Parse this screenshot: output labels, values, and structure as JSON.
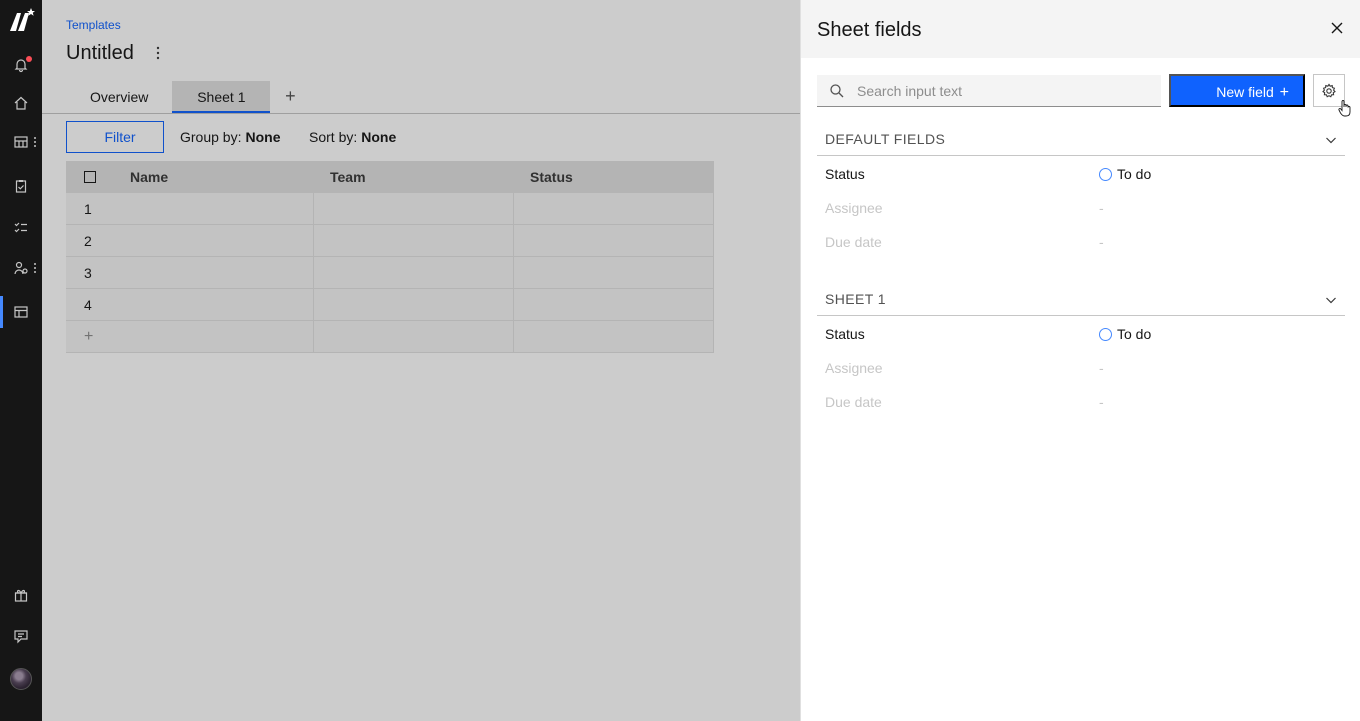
{
  "rail": {
    "items": [
      {
        "icon": "notification-icon"
      },
      {
        "icon": "home-icon"
      },
      {
        "icon": "table-icon"
      },
      {
        "icon": "clipboard-check-icon"
      },
      {
        "icon": "task-list-icon"
      },
      {
        "icon": "user-roles-icon"
      },
      {
        "icon": "template-icon"
      }
    ],
    "bottom": [
      {
        "icon": "gift-icon"
      },
      {
        "icon": "chat-icon"
      },
      {
        "icon": "avatar"
      }
    ]
  },
  "page": {
    "breadcrumb": "Templates",
    "title": "Untitled",
    "tabs": [
      {
        "label": "Overview",
        "selected": false
      },
      {
        "label": "Sheet 1",
        "selected": true
      }
    ],
    "add_tab": "+"
  },
  "toolbar": {
    "filter_label": "Filter",
    "group_by_label": "Group by:",
    "group_by_value": "None",
    "sort_by_label": "Sort by:",
    "sort_by_value": "None"
  },
  "grid": {
    "columns": [
      "Name",
      "Team",
      "Status"
    ],
    "rows": [
      "1",
      "2",
      "3",
      "4"
    ],
    "add_row": "+"
  },
  "panel": {
    "title": "Sheet fields",
    "search_placeholder": "Search input text",
    "new_field_label": "New field",
    "new_field_plus": "+",
    "sections": [
      {
        "title": "DEFAULT FIELDS",
        "fields": [
          {
            "label": "Status",
            "value": "To do",
            "dim": false,
            "ring": true
          },
          {
            "label": "Assignee",
            "value": "-",
            "dim": true
          },
          {
            "label": "Due date",
            "value": "-",
            "dim": true
          }
        ]
      },
      {
        "title": "SHEET 1",
        "fields": [
          {
            "label": "Status",
            "value": "To do",
            "dim": false,
            "ring": true
          },
          {
            "label": "Assignee",
            "value": "-",
            "dim": true
          },
          {
            "label": "Due date",
            "value": "-",
            "dim": true
          }
        ]
      }
    ]
  },
  "colors": {
    "accent": "#0f62fe",
    "rail_bg": "#161616",
    "panel_header_bg": "#f4f4f4",
    "notification_dot": "#fa4d56"
  }
}
